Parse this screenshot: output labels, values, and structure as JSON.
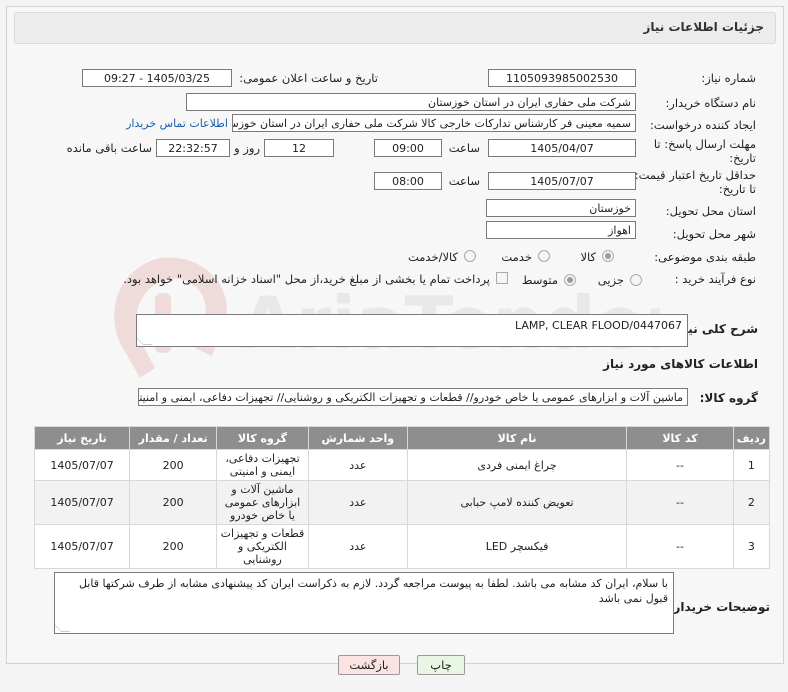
{
  "header": {
    "title": "جزئیات اطلاعات نیاز"
  },
  "fields": {
    "need_number": {
      "label": "شماره نیاز:",
      "value": "1105093985002530"
    },
    "announce_datetime": {
      "label": "تاریخ و ساعت اعلان عمومی:",
      "value": "1405/03/25 - 09:27"
    },
    "buyer_org": {
      "label": "نام دستگاه خریدار:",
      "value": "شرکت ملی حفاری ایران در استان خوزستان"
    },
    "requester": {
      "label": "ایجاد کننده درخواست:",
      "value": "سمیه معینی فر کارشناس تدارکات خارجی کالا شرکت ملی حفاری ایران در استان خوزستان"
    },
    "buyer_contact_link": "اطلاعات تماس خریدار",
    "reply_deadline": {
      "label_line1": "مهلت ارسال پاسخ: تا",
      "label_line2": "تاریخ:",
      "date": "1405/04/07",
      "time_label": "ساعت",
      "time": "09:00",
      "days": "12",
      "days_label": "روز و",
      "remaining": "22:32:57",
      "remaining_label": "ساعت باقی مانده"
    },
    "price_validity": {
      "label_line1": "حداقل تاریخ اعتبار قیمت:",
      "label_line2": "تا تاریخ:",
      "date": "1405/07/07",
      "time_label": "ساعت",
      "time": "08:00"
    },
    "delivery_province": {
      "label": "استان محل تحویل:",
      "value": "خوزستان"
    },
    "delivery_city": {
      "label": "شهر محل تحویل:",
      "value": "اهواز"
    },
    "category": {
      "label": "طبقه بندی موضوعی:",
      "options": [
        "کالا",
        "خدمت",
        "کالا/خدمت"
      ],
      "selected": "کالا"
    },
    "process_type": {
      "label": "نوع فرآیند خرید :",
      "options": [
        "جزیی",
        "متوسط"
      ],
      "selected": "متوسط",
      "payment_note": "پرداخت تمام یا بخشی از مبلغ خرید،از محل \"اسناد خزانه اسلامی\" خواهد بود."
    }
  },
  "general_desc": {
    "label": "شرح کلی نیاز:",
    "value": "LAMP, CLEAR FLOOD/0447067"
  },
  "goods_info_title": "اطلاعات کالاهای مورد نیاز",
  "goods_group": {
    "label": "گروه کالا:",
    "value": "ماشین آلات و ابزارهای عمومی یا خاص خودرو// قطعات و تجهیزات الکتریکی و روشنایی// تجهیزات دفاعی، ایمنی و امنیتی"
  },
  "table": {
    "headers": [
      "ردیف",
      "کد کالا",
      "نام کالا",
      "واحد شمارش",
      "گروه کالا",
      "تعداد / مقدار",
      "تاریخ نیاز"
    ],
    "rows": [
      {
        "row": "1",
        "code": "--",
        "name": "چراغ ایمنی فردی",
        "unit": "عدد",
        "group": "تجهیزات دفاعی، ایمنی و امنیتی",
        "qty": "200",
        "date": "1405/07/07"
      },
      {
        "row": "2",
        "code": "--",
        "name": "تعویض کننده لامپ حبابی",
        "unit": "عدد",
        "group": "ماشین آلات و ابزارهای عمومی یا خاص خودرو",
        "qty": "200",
        "date": "1405/07/07"
      },
      {
        "row": "3",
        "code": "--",
        "name": "فیکسچر LED",
        "unit": "عدد",
        "group": "قطعات و تجهیزات الکتریکی و روشنایی",
        "qty": "200",
        "date": "1405/07/07"
      }
    ]
  },
  "buyer_notes": {
    "label": "توضیحات خریدار:",
    "value": "با سلام، ایران کد مشابه می باشد. لطفا به پیوست مراجعه گردد. لازم به ذکراست ایران کد پیشنهادی مشابه از طرف شرکتها قابل قبول نمی باشد"
  },
  "buttons": {
    "print": "چاپ",
    "back": "بازگشت"
  },
  "watermark": {
    "text": "AriaTender.net"
  },
  "colors": {
    "table_header": "#8e8e8e",
    "link": "#1a5dab",
    "print_button": "#eaf6e4",
    "back_button": "#fbe3e3"
  }
}
